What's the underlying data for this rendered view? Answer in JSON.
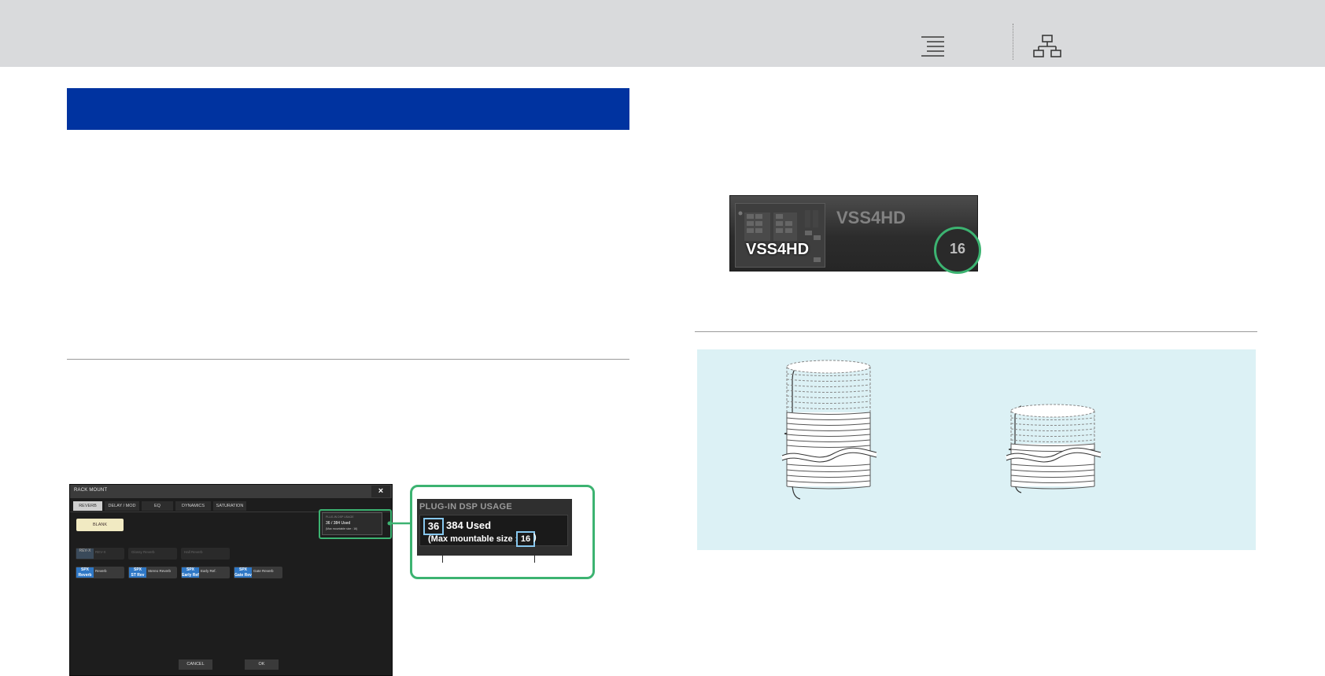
{
  "topbar": {
    "icons": [
      "table-of-contents-icon",
      "site-map-icon"
    ]
  },
  "colors": {
    "topbar_bg": "#d9dadc",
    "banner_blue": "#0033a0",
    "highlight_green": "#3cb371",
    "callout_blue": "#87c8ef",
    "note_bg": "#dcf1f5"
  },
  "rack_mount": {
    "title": "RACK MOUNT",
    "close_label": "×",
    "tabs": [
      "REVERB",
      "DELAY / MOD",
      "EQ",
      "DYNAMICS",
      "SATURATION"
    ],
    "active_tab": "REVERB",
    "blank_label": "BLANK",
    "tiles_row1": [
      {
        "logo": "REV-X",
        "name": "REV-X"
      },
      {
        "logo": "",
        "name": "Glossy Reverb"
      },
      {
        "logo": "",
        "name": "Hall Reverb"
      }
    ],
    "tiles_row2": [
      {
        "logo": "SPX",
        "name": "Reverb",
        "tag": "Reverb"
      },
      {
        "logo": "SPX",
        "name": "Stereo Reverb",
        "tag": "ST Rev"
      },
      {
        "logo": "SPX",
        "name": "Early Ref.",
        "tag": "Early Ref"
      },
      {
        "logo": "SPX",
        "name": "Gate Reverb",
        "tag": "Gate Rev"
      }
    ],
    "mini_usage": {
      "title": "PLUG-IN DSP USAGE",
      "used": "36 / 384 Used",
      "max": "(Max mountable size : 16)"
    },
    "cancel_label": "CANCEL",
    "ok_label": "OK"
  },
  "dsp_usage_callout": {
    "title": "PLUG-IN DSP USAGE",
    "used_value": "36",
    "used_suffix": "384 Used",
    "max_prefix": "(Max mountable size :",
    "max_value": "16",
    "max_suffix": ")"
  },
  "vss_module": {
    "name_large": "VSS4HD",
    "name_small": "VSS4HD",
    "size_badge": "16"
  }
}
